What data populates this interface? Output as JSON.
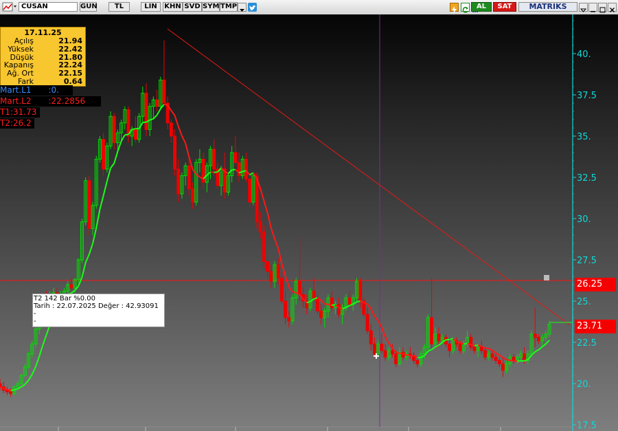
{
  "toolbar": {
    "symbol": "CUSAN",
    "buttons": [
      "GUN",
      "TL",
      "LIN",
      "KHN",
      "SVD",
      "SYM",
      "TMP"
    ],
    "al_label": "AL",
    "sat_label": "SAT",
    "brand": "MATRIKS",
    "colors": {
      "al": "#1f8a1f",
      "sat": "#d61818",
      "brand": "#1a2f7a"
    }
  },
  "ohlc": {
    "date": "17.11.25",
    "rows": [
      {
        "label": "Açılış",
        "value": "21.94"
      },
      {
        "label": "Yüksek",
        "value": "22.42"
      },
      {
        "label": "Düşük",
        "value": "21.80"
      },
      {
        "label": "Kapanış",
        "value": "22.24"
      },
      {
        "label": "Ağ. Ort",
        "value": "22.15"
      },
      {
        "label": "Fark",
        "value": "0.64"
      }
    ]
  },
  "indicators": [
    {
      "label": "Mart.L1",
      "value": ":0.",
      "color": "#3a8cff"
    },
    {
      "label": "Mart.L2",
      "value": ":22.2856",
      "color": "#ff2020"
    },
    {
      "label": "T1:31.73",
      "value": "",
      "color": "#ff2020"
    },
    {
      "label": "T2:26.2",
      "value": "",
      "color": "#ff2020"
    }
  ],
  "info_box": {
    "line1": "T2   142 Bar   %0.00",
    "line2": "Tarih : 22.07.2025 Değer : 42.93091",
    "line3": "-",
    "line4": "-"
  },
  "price_tags": {
    "level": "26.25",
    "last": "23.71"
  },
  "chart_data": {
    "type": "candlestick",
    "ylim": [
      17.5,
      42
    ],
    "y_ticks": [
      "17.5",
      "20.",
      "22.5",
      "25.",
      "27.5",
      "30.",
      "32.5",
      "35.",
      "37.5",
      "40."
    ],
    "up_color": "#00e000",
    "down_color": "#ee0000",
    "horizontal_line": 26.25,
    "last_price": 23.71,
    "trendline": {
      "from_bar": 46,
      "from_value": 41.0,
      "to_bar": 161,
      "to_value": 22.7
    },
    "candles": [
      [
        20.0,
        20.3,
        19.6,
        19.8
      ],
      [
        19.8,
        20.1,
        19.4,
        19.6
      ],
      [
        19.6,
        19.8,
        19.3,
        19.5
      ],
      [
        19.5,
        19.7,
        19.2,
        19.4
      ],
      [
        19.4,
        19.9,
        19.3,
        19.8
      ],
      [
        19.8,
        20.2,
        19.6,
        20.0
      ],
      [
        20.0,
        20.6,
        19.9,
        20.5
      ],
      [
        20.5,
        21.2,
        20.4,
        21.0
      ],
      [
        21.0,
        21.9,
        20.9,
        21.8
      ],
      [
        21.8,
        22.6,
        21.6,
        22.4
      ],
      [
        22.4,
        23.5,
        22.2,
        23.3
      ],
      [
        23.3,
        24.6,
        23.0,
        24.4
      ],
      [
        24.4,
        25.4,
        24.2,
        25.2
      ],
      [
        25.2,
        25.6,
        24.8,
        25.0
      ],
      [
        25.0,
        25.6,
        24.6,
        25.4
      ],
      [
        25.4,
        25.8,
        25.0,
        25.5
      ],
      [
        25.5,
        25.8,
        25.0,
        25.2
      ],
      [
        25.2,
        25.6,
        24.9,
        25.4
      ],
      [
        25.4,
        25.8,
        25.1,
        25.6
      ],
      [
        25.6,
        26.2,
        25.4,
        26.0
      ],
      [
        26.0,
        26.4,
        25.6,
        25.8
      ],
      [
        25.8,
        26.4,
        25.5,
        26.3
      ],
      [
        26.3,
        27.6,
        26.1,
        27.5
      ],
      [
        27.5,
        30.0,
        27.3,
        29.8
      ],
      [
        29.8,
        32.5,
        29.6,
        32.3
      ],
      [
        32.3,
        32.6,
        29.0,
        29.4
      ],
      [
        29.4,
        31.0,
        29.0,
        30.8
      ],
      [
        30.8,
        33.8,
        30.6,
        33.6
      ],
      [
        33.6,
        35.0,
        33.4,
        34.8
      ],
      [
        34.8,
        35.2,
        32.6,
        33.0
      ],
      [
        33.0,
        34.6,
        32.8,
        34.4
      ],
      [
        34.4,
        36.5,
        34.2,
        36.2
      ],
      [
        36.2,
        36.4,
        34.2,
        34.6
      ],
      [
        34.6,
        35.4,
        34.0,
        35.2
      ],
      [
        35.2,
        36.0,
        34.6,
        35.8
      ],
      [
        35.8,
        36.8,
        35.4,
        36.6
      ],
      [
        36.6,
        36.8,
        34.6,
        35.0
      ],
      [
        35.0,
        35.6,
        34.4,
        35.4
      ],
      [
        35.4,
        36.2,
        34.6,
        34.8
      ],
      [
        34.8,
        36.4,
        34.6,
        36.2
      ],
      [
        36.2,
        38.0,
        35.8,
        37.6
      ],
      [
        37.6,
        38.2,
        35.0,
        35.4
      ],
      [
        35.4,
        37.0,
        35.0,
        36.8
      ],
      [
        36.8,
        37.4,
        36.0,
        37.2
      ],
      [
        37.2,
        37.8,
        36.5,
        36.8
      ],
      [
        36.8,
        38.6,
        36.6,
        38.4
      ],
      [
        38.4,
        40.8,
        38.0,
        37.0
      ],
      [
        37.0,
        37.4,
        35.4,
        35.8
      ],
      [
        35.8,
        36.0,
        34.6,
        35.0
      ],
      [
        35.0,
        35.4,
        32.6,
        33.0
      ],
      [
        33.0,
        33.6,
        31.0,
        31.5
      ],
      [
        31.5,
        32.8,
        31.2,
        32.6
      ],
      [
        32.6,
        33.4,
        32.0,
        33.2
      ],
      [
        33.2,
        33.8,
        31.4,
        31.8
      ],
      [
        31.8,
        32.2,
        30.6,
        31.0
      ],
      [
        31.0,
        33.6,
        30.8,
        33.4
      ],
      [
        33.4,
        34.2,
        32.8,
        33.6
      ],
      [
        33.6,
        34.0,
        31.8,
        32.2
      ],
      [
        32.2,
        33.4,
        31.6,
        33.2
      ],
      [
        33.2,
        34.4,
        32.4,
        34.2
      ],
      [
        34.2,
        34.8,
        32.6,
        33.0
      ],
      [
        33.0,
        33.4,
        31.8,
        32.0
      ],
      [
        32.0,
        33.2,
        31.4,
        33.0
      ],
      [
        33.0,
        34.0,
        31.2,
        31.6
      ],
      [
        31.6,
        32.8,
        31.4,
        32.6
      ],
      [
        32.6,
        34.4,
        32.2,
        34.0
      ],
      [
        34.0,
        35.0,
        33.2,
        33.4
      ],
      [
        33.4,
        34.0,
        32.2,
        32.6
      ],
      [
        32.6,
        33.8,
        32.4,
        33.6
      ],
      [
        33.6,
        34.0,
        32.2,
        32.4
      ],
      [
        32.4,
        32.8,
        30.6,
        31.0
      ],
      [
        31.0,
        32.8,
        30.8,
        32.6
      ],
      [
        32.6,
        32.8,
        29.4,
        29.8
      ],
      [
        29.8,
        30.4,
        28.8,
        29.2
      ],
      [
        29.2,
        29.6,
        27.0,
        27.4
      ],
      [
        27.4,
        28.0,
        26.4,
        26.8
      ],
      [
        26.8,
        27.2,
        25.8,
        26.2
      ],
      [
        26.2,
        27.4,
        25.8,
        27.2
      ],
      [
        27.2,
        27.6,
        26.0,
        26.4
      ],
      [
        26.4,
        26.8,
        24.8,
        25.0
      ],
      [
        25.0,
        25.6,
        23.6,
        24.0
      ],
      [
        24.0,
        24.4,
        23.4,
        23.8
      ],
      [
        23.8,
        25.4,
        23.6,
        25.2
      ],
      [
        25.2,
        26.4,
        24.8,
        26.2
      ],
      [
        26.2,
        28.8,
        25.0,
        25.4
      ],
      [
        25.4,
        25.8,
        24.6,
        25.0
      ],
      [
        25.0,
        25.4,
        24.2,
        24.6
      ],
      [
        24.6,
        25.8,
        24.4,
        25.6
      ],
      [
        25.6,
        26.4,
        25.0,
        25.2
      ],
      [
        25.2,
        25.4,
        24.2,
        24.4
      ],
      [
        24.4,
        24.8,
        23.6,
        24.0
      ],
      [
        24.0,
        24.6,
        23.4,
        24.4
      ],
      [
        24.4,
        25.4,
        24.0,
        25.2
      ],
      [
        25.2,
        25.6,
        24.4,
        24.6
      ],
      [
        24.6,
        25.0,
        24.2,
        24.8
      ],
      [
        24.8,
        25.2,
        24.0,
        24.2
      ],
      [
        24.2,
        24.8,
        23.6,
        24.6
      ],
      [
        24.6,
        25.4,
        24.4,
        25.2
      ],
      [
        25.2,
        25.6,
        24.6,
        24.8
      ],
      [
        24.8,
        25.4,
        24.4,
        25.2
      ],
      [
        25.2,
        26.4,
        25.0,
        26.2
      ],
      [
        26.2,
        26.4,
        24.6,
        25.0
      ],
      [
        25.0,
        25.2,
        24.0,
        24.2
      ],
      [
        24.2,
        24.6,
        23.0,
        23.2
      ],
      [
        23.2,
        23.6,
        22.0,
        22.4
      ],
      [
        22.4,
        22.8,
        21.6,
        21.8
      ],
      [
        21.8,
        22.6,
        21.6,
        22.4
      ],
      [
        22.4,
        23.0,
        21.8,
        22.0
      ],
      [
        22.0,
        22.4,
        21.4,
        21.6
      ],
      [
        21.6,
        22.2,
        21.4,
        22.0
      ],
      [
        22.0,
        22.4,
        21.6,
        21.8
      ],
      [
        21.8,
        22.0,
        21.0,
        21.2
      ],
      [
        21.2,
        22.2,
        21.1,
        21.9
      ],
      [
        21.9,
        22.2,
        21.4,
        21.6
      ],
      [
        21.6,
        22.0,
        21.4,
        21.8
      ],
      [
        21.8,
        22.2,
        21.5,
        21.7
      ],
      [
        21.7,
        21.9,
        21.2,
        21.4
      ],
      [
        21.4,
        21.6,
        21.0,
        21.2
      ],
      [
        21.2,
        22.0,
        21.0,
        21.8
      ],
      [
        21.8,
        22.4,
        21.5,
        22.2
      ],
      [
        22.2,
        24.2,
        22.0,
        24.0
      ],
      [
        24.0,
        26.4,
        22.0,
        22.4
      ],
      [
        22.4,
        23.4,
        22.2,
        23.0
      ],
      [
        23.0,
        23.4,
        22.2,
        22.6
      ],
      [
        22.6,
        23.0,
        22.4,
        22.8
      ],
      [
        22.8,
        23.0,
        22.2,
        22.4
      ],
      [
        22.4,
        22.8,
        21.6,
        22.0
      ],
      [
        22.0,
        22.8,
        21.8,
        22.6
      ],
      [
        22.6,
        22.8,
        22.2,
        22.4
      ],
      [
        22.4,
        22.6,
        21.8,
        22.0
      ],
      [
        22.0,
        22.6,
        21.8,
        22.4
      ],
      [
        22.4,
        23.2,
        22.2,
        22.8
      ],
      [
        22.8,
        23.0,
        22.0,
        22.2
      ],
      [
        22.2,
        22.4,
        21.8,
        22.0
      ],
      [
        22.0,
        22.4,
        21.6,
        22.2
      ],
      [
        22.2,
        22.6,
        21.8,
        22.0
      ],
      [
        22.0,
        22.2,
        21.4,
        21.6
      ],
      [
        21.6,
        22.0,
        21.4,
        21.8
      ],
      [
        21.8,
        22.0,
        21.4,
        21.6
      ],
      [
        21.6,
        21.8,
        21.2,
        21.4
      ],
      [
        21.4,
        21.6,
        21.0,
        21.2
      ],
      [
        21.2,
        21.6,
        20.4,
        20.8
      ],
      [
        20.8,
        21.4,
        20.6,
        21.2
      ],
      [
        21.2,
        21.8,
        21.0,
        21.6
      ],
      [
        21.6,
        21.8,
        21.2,
        21.4
      ],
      [
        21.4,
        21.8,
        21.2,
        21.6
      ],
      [
        21.6,
        22.0,
        21.4,
        21.8
      ],
      [
        21.8,
        22.2,
        21.2,
        21.4
      ],
      [
        21.4,
        22.0,
        21.2,
        21.8
      ],
      [
        21.8,
        23.2,
        21.6,
        23.0
      ],
      [
        23.0,
        24.6,
        22.2,
        22.8
      ],
      [
        22.8,
        23.0,
        22.4,
        22.6
      ],
      [
        22.6,
        23.0,
        22.2,
        22.8
      ],
      [
        22.8,
        23.2,
        22.6,
        23.0
      ],
      [
        23.0,
        23.8,
        22.8,
        23.6
      ]
    ]
  }
}
